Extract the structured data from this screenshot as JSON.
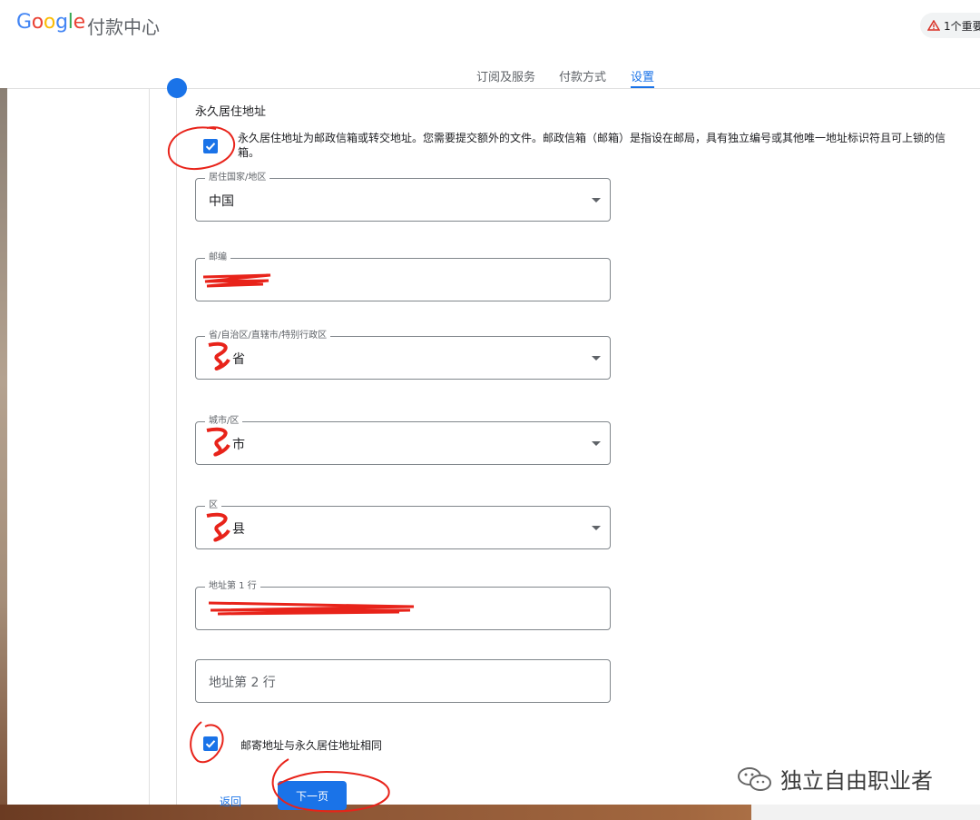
{
  "header": {
    "logo_text": "Google",
    "product_name": "付款中心",
    "alert_text": "1个重要"
  },
  "tabs": [
    {
      "label": "订阅及服务"
    },
    {
      "label": "付款方式"
    },
    {
      "label": "设置"
    }
  ],
  "form": {
    "section_title": "永久居住地址",
    "permanent_address_checked": true,
    "notice_text": "永久居住地址为邮政信箱或转交地址。您需要提交额外的文件。邮政信箱（邮箱）是指设在邮局，具有独立编号或其他唯一地址标识符且可上锁的信箱。",
    "fields": {
      "country": {
        "label": "居住国家/地区",
        "value": "中国"
      },
      "postal": {
        "label": "邮编",
        "value": ""
      },
      "province": {
        "label": "省/自治区/直辖市/特别行政区",
        "value": "省"
      },
      "city": {
        "label": "城市/区",
        "value": "市"
      },
      "district": {
        "label": "区",
        "value": "县"
      },
      "address1": {
        "label": "地址第 1 行",
        "value": ""
      },
      "address2": {
        "placeholder": "地址第 2 行"
      }
    },
    "mailing_same_label": "邮寄地址与永久居住地址相同",
    "mailing_same_checked": true,
    "back_label": "返回",
    "next_label": "下一页"
  },
  "watermark": {
    "text": "独立自由职业者"
  },
  "colors": {
    "accent": "#1a73e8",
    "annotation": "#e8231a"
  }
}
